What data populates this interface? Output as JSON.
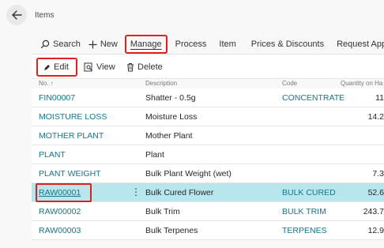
{
  "page": {
    "title": "Items"
  },
  "actionbar": {
    "search": "Search",
    "new": "New",
    "manage": "Manage",
    "process": "Process",
    "item": "Item",
    "prices": "Prices & Discounts",
    "request": "Request Approval"
  },
  "manage_menu": {
    "edit": "Edit",
    "view": "View",
    "delete": "Delete"
  },
  "columns": {
    "no": "No. ↑",
    "description": "Description",
    "code": "Code",
    "qty": "Quantity on Ha"
  },
  "rows": [
    {
      "no": "FIN00007",
      "description": "Shatter - 0.5g",
      "code": "CONCENTRATE",
      "qty": "11"
    },
    {
      "no": "MOISTURE LOSS",
      "description": "Moisture Loss",
      "code": "",
      "qty": "14.2"
    },
    {
      "no": "MOTHER PLANT",
      "description": "Mother Plant",
      "code": "",
      "qty": ""
    },
    {
      "no": "PLANT",
      "description": "Plant",
      "code": "",
      "qty": ""
    },
    {
      "no": "PLANT WEIGHT",
      "description": "Bulk Plant Weight (wet)",
      "code": "",
      "qty": "7.3"
    },
    {
      "no": "RAW00001",
      "description": "Bulk Cured Flower",
      "code": "BULK CURED",
      "qty": "52.6"
    },
    {
      "no": "RAW00002",
      "description": "Bulk Trim",
      "code": "BULK TRIM",
      "qty": "243.7"
    },
    {
      "no": "RAW00003",
      "description": "Bulk Terpenes",
      "code": "TERPENES",
      "qty": "12.9"
    }
  ],
  "selected_row_index": 5,
  "colors": {
    "link": "#15768a",
    "selected": "#b7e6ec",
    "highlight_box": "#e02020"
  }
}
